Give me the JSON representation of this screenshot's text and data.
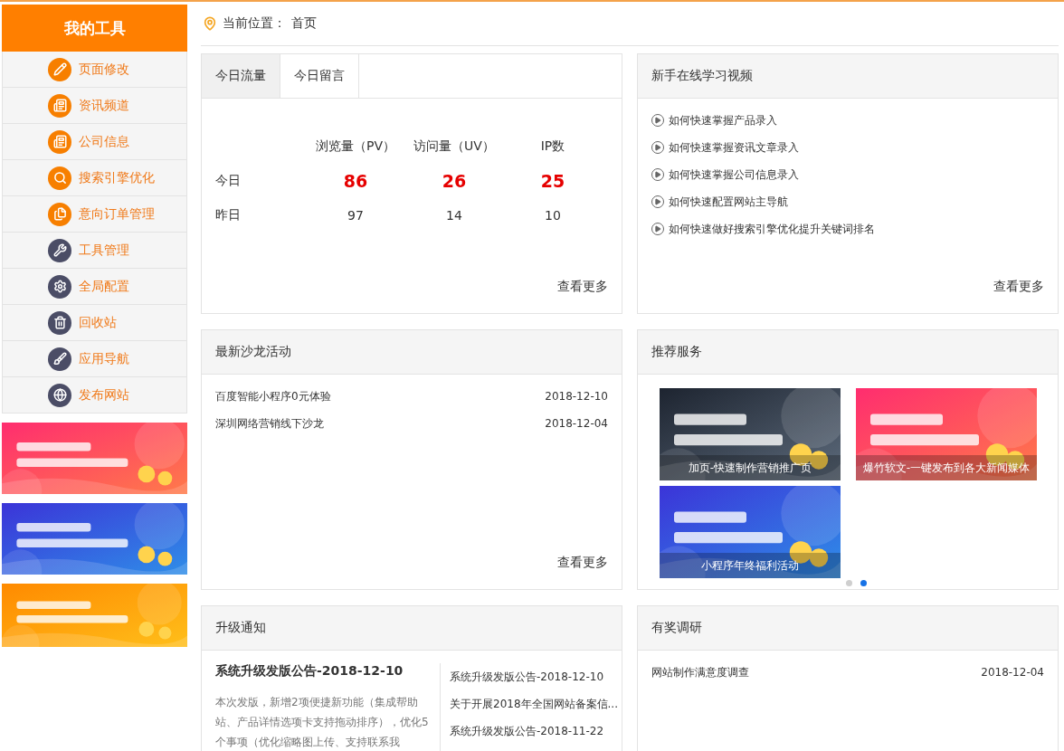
{
  "sidebar": {
    "title": "我的工具",
    "items": [
      {
        "label": "页面修改",
        "color": "#f77f00"
      },
      {
        "label": "资讯频道",
        "color": "#f77f00"
      },
      {
        "label": "公司信息",
        "color": "#f77f00"
      },
      {
        "label": "搜索引擎优化",
        "color": "#f77f00"
      },
      {
        "label": "意向订单管理",
        "color": "#f77f00"
      },
      {
        "label": "工具管理",
        "color": "#4b4d66"
      },
      {
        "label": "全局配置",
        "color": "#4b4d66"
      },
      {
        "label": "回收站",
        "color": "#4b4d66"
      },
      {
        "label": "应用导航",
        "color": "#4b4d66"
      },
      {
        "label": "发布网站",
        "color": "#4b4d66"
      }
    ]
  },
  "breadcrumb": {
    "label": "当前位置：",
    "current": "首页"
  },
  "traffic": {
    "tabs": [
      {
        "label": "今日流量",
        "selected": true
      },
      {
        "label": "今日留言",
        "selected": false
      }
    ],
    "columns": [
      "浏览量（PV）",
      "访问量（UV）",
      "IP数"
    ],
    "rows": [
      {
        "label": "今日",
        "values": [
          "86",
          "26",
          "25"
        ],
        "highlight": true
      },
      {
        "label": "昨日",
        "values": [
          "97",
          "14",
          "10"
        ],
        "highlight": false
      }
    ],
    "more": "查看更多"
  },
  "videos": {
    "title": "新手在线学习视频",
    "items": [
      "如何快速掌握产品录入",
      "如何快速掌握资讯文章录入",
      "如何快速掌握公司信息录入",
      "如何快速配置网站主导航",
      "如何快速做好搜索引擎优化提升关键词排名"
    ],
    "more": "查看更多"
  },
  "salons": {
    "title": "最新沙龙活动",
    "items": [
      {
        "title": "百度智能小程序0元体验",
        "date": "2018-12-10"
      },
      {
        "title": "深圳网络营销线下沙龙",
        "date": "2018-12-04"
      }
    ],
    "more": "查看更多"
  },
  "services": {
    "title": "推荐服务",
    "cards": [
      {
        "caption": "加页-快速制作营销推广页"
      },
      {
        "caption": "爆竹软文-一键发布到各大新闻媒体"
      },
      {
        "caption": "小程序年终福利活动"
      }
    ],
    "dots": [
      {
        "selected": false
      },
      {
        "selected": true
      }
    ]
  },
  "upgrades": {
    "title": "升级通知",
    "headline": "系统升级发版公告-2018-12-10",
    "body": "本次发版，新增2项便捷新功能（集成帮助站、产品详情选项卡支持拖动排序），优化5个事项（优化缩略图上传、支持联系我",
    "items": [
      "系统升级发版公告-2018-12-10",
      "关于开展2018年全国网站备案信...",
      "系统升级发版公告-2018-11-22"
    ]
  },
  "surveys": {
    "title": "有奖调研",
    "items": [
      {
        "title": "网站制作满意度调查",
        "date": "2018-12-04"
      }
    ]
  }
}
